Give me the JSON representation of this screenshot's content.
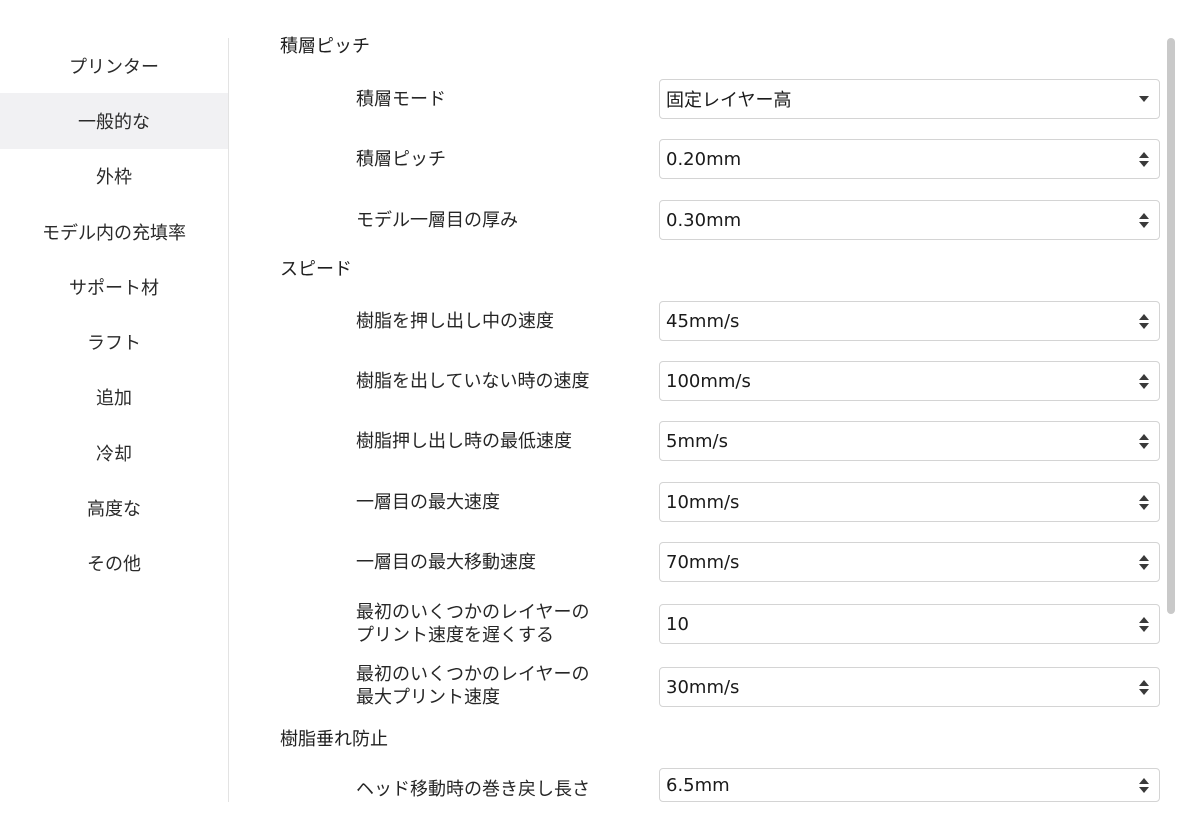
{
  "sidebar": {
    "items": [
      {
        "label": "プリンター"
      },
      {
        "label": "一般的な"
      },
      {
        "label": "外枠"
      },
      {
        "label": "モデル内の充填率"
      },
      {
        "label": "サポート材"
      },
      {
        "label": "ラフト"
      },
      {
        "label": "追加"
      },
      {
        "label": "冷却"
      },
      {
        "label": "高度な"
      },
      {
        "label": "その他"
      }
    ],
    "active_index": 1
  },
  "sections": {
    "layer": {
      "title": "積層ピッチ",
      "mode_label": "積層モード",
      "mode_value": "固定レイヤー高",
      "pitch_label": "積層ピッチ",
      "pitch_value": "0.20mm",
      "first_layer_label": "モデル一層目の厚み",
      "first_layer_value": "0.30mm"
    },
    "speed": {
      "title": "スピード",
      "print_speed_label": "樹脂を押し出し中の速度",
      "print_speed_value": "45mm/s",
      "travel_speed_label": "樹脂を出していない時の速度",
      "travel_speed_value": "100mm/s",
      "min_speed_label": "樹脂押し出し時の最低速度",
      "min_speed_value": "5mm/s",
      "first_max_label": "一層目の最大速度",
      "first_max_value": "10mm/s",
      "first_travel_label": "一層目の最大移動速度",
      "first_travel_value": "70mm/s",
      "slow_layers_label_1": "最初のいくつかのレイヤーの",
      "slow_layers_label_2": "プリント速度を遅くする",
      "slow_layers_value": "10",
      "slow_max_label_1": "最初のいくつかのレイヤーの",
      "slow_max_label_2": "最大プリント速度",
      "slow_max_value": "30mm/s"
    },
    "retraction": {
      "title": "樹脂垂れ防止",
      "length_label": "ヘッド移動時の巻き戻し長さ",
      "length_value": "6.5mm"
    }
  },
  "icons": {
    "dropdown": "chevron-down-icon",
    "stepper": "stepper-icon"
  }
}
